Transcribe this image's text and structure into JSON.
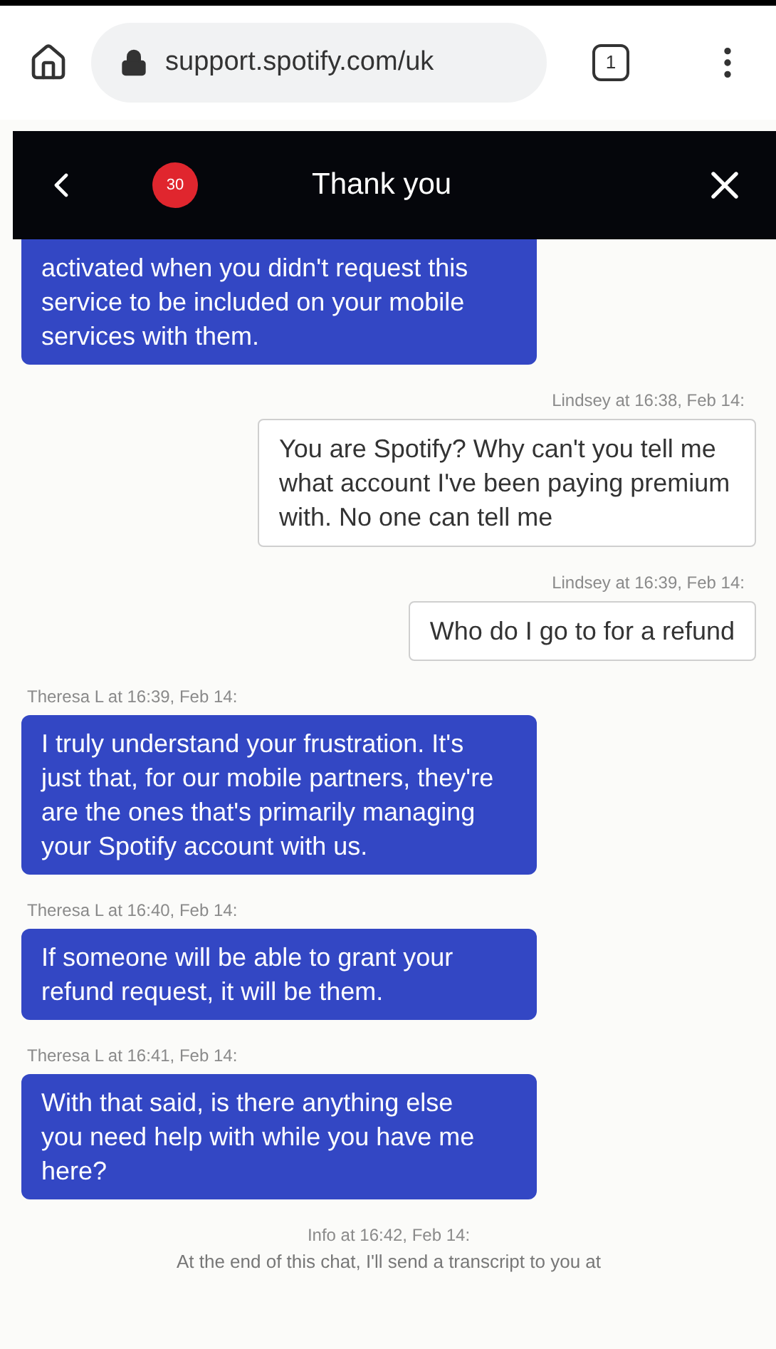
{
  "browser": {
    "url": "support.spotify.com/uk",
    "tab_count": "1"
  },
  "chat": {
    "title": "Thank you",
    "badge": "30",
    "messages": [
      {
        "kind": "agent",
        "text": "activated when you didn't request this service to be included on your mobile services with them."
      },
      {
        "kind": "customer",
        "meta": "Lindsey at 16:38, Feb 14:",
        "text": "You are Spotify? Why can't you tell me what account I've been paying premium with. No one can tell me"
      },
      {
        "kind": "customer",
        "meta": "Lindsey at 16:39, Feb 14:",
        "text": "Who do I go to for a refund"
      },
      {
        "kind": "agent",
        "meta": "Theresa L at 16:39, Feb 14:",
        "text": "I truly understand your frustration. It's just that, for our mobile partners, they're are the ones that's primarily managing your Spotify account with us."
      },
      {
        "kind": "agent",
        "meta": "Theresa L at 16:40, Feb 14:",
        "text": "If someone will be able to grant your refund request, it will be them."
      },
      {
        "kind": "agent",
        "meta": "Theresa L at 16:41, Feb 14:",
        "text": "With that said, is there anything else you need help with while you have me here?"
      },
      {
        "kind": "info",
        "meta": "Info at 16:42, Feb 14:",
        "text": "At the end of this chat, I'll send a transcript to you at"
      }
    ]
  }
}
